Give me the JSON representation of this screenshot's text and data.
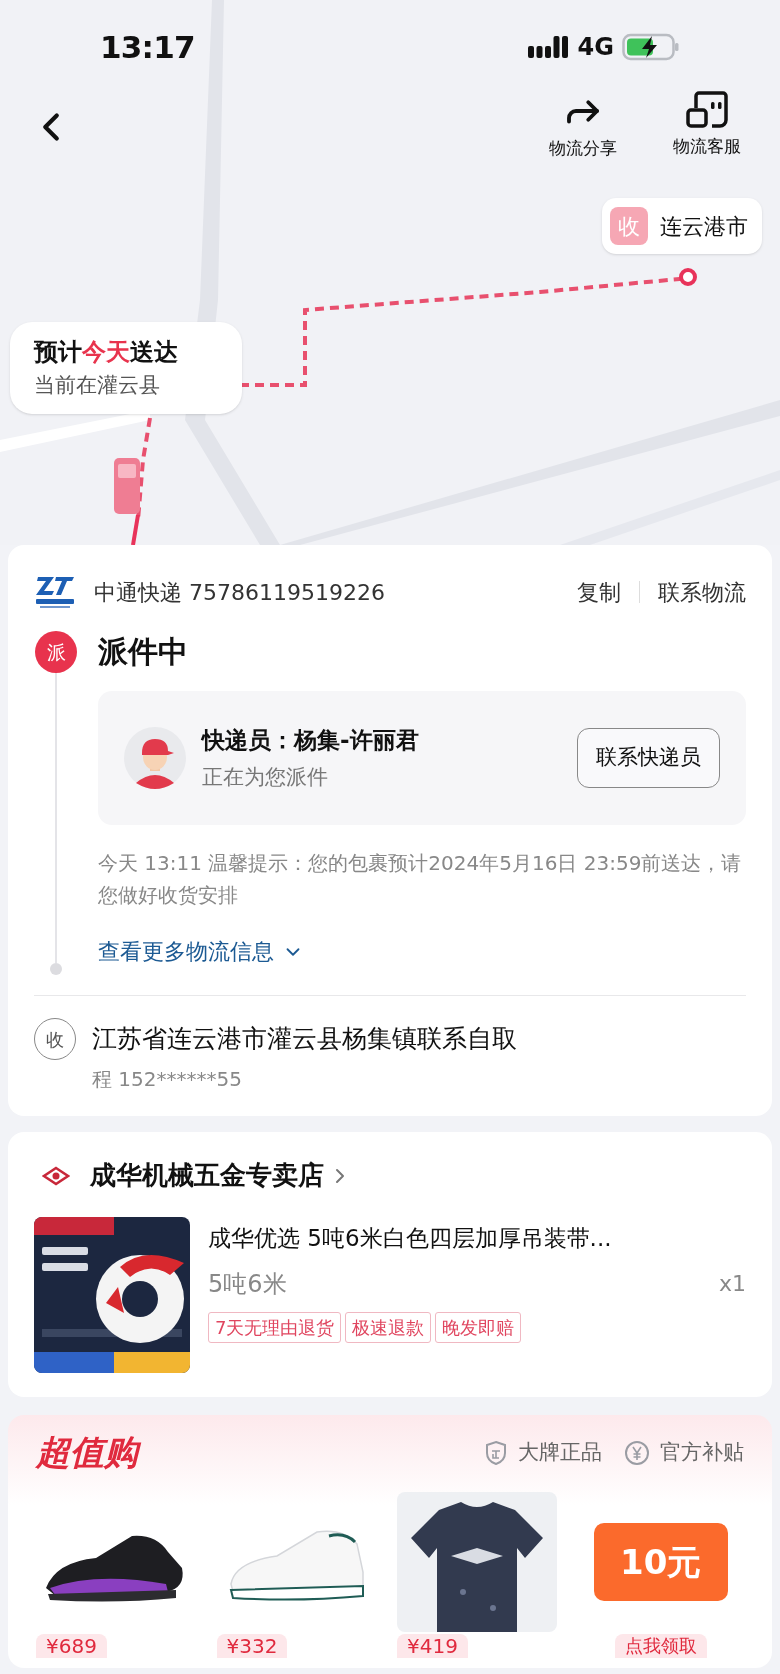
{
  "status_bar": {
    "time": "13:17",
    "network": "4G"
  },
  "nav": {
    "actions": [
      {
        "label": "物流分享",
        "kind": "share"
      },
      {
        "label": "物流客服",
        "kind": "service"
      }
    ]
  },
  "map": {
    "eta_bubble": {
      "headline": "预计**今天**送达",
      "location": "当前在灌云县"
    },
    "destination": {
      "badge": "收",
      "label": "连云港市"
    }
  },
  "tracking": {
    "carrier": "中通快递 75786119519226",
    "actions": [
      "复制",
      "联系物流"
    ],
    "status_badge": "派",
    "status": "派件中",
    "courier": {
      "title": "快递员：杨集-许丽君",
      "subtitle": "正在为您派件",
      "button": "联系快递员"
    },
    "notice": "今天 13:11 温馨提示：您的包裹预计2024年5月16日 23:59前送达，请您做好收货安排",
    "more_link": {
      "label": "查看更多物流信息",
      "expanded": false
    },
    "address_badge": "收",
    "address": "江苏省连云港市灌云县杨集镇联系自取",
    "contact": "程 152******55"
  },
  "order": {
    "shop": "成华机械五金专卖店",
    "product": {
      "title": "成华优选 5吨6米白色四层加厚吊装带...",
      "spec": "5吨6米",
      "quantity": "x1",
      "tags": [
        "7天无理由退货",
        "极速退款",
        "晚发即赔"
      ]
    }
  },
  "deals": {
    "title": "超值购",
    "badges": [
      {
        "label": "大牌正品",
        "kind": "genuine"
      },
      {
        "label": "官方补贴",
        "kind": "subsidy"
      }
    ],
    "items": [
      {
        "kind": "product",
        "price": "¥689"
      },
      {
        "kind": "product",
        "price": "¥332"
      },
      {
        "kind": "product",
        "price": "¥419"
      },
      {
        "kind": "coupon",
        "amount": "10元",
        "price": "点我领取"
      }
    ]
  }
}
